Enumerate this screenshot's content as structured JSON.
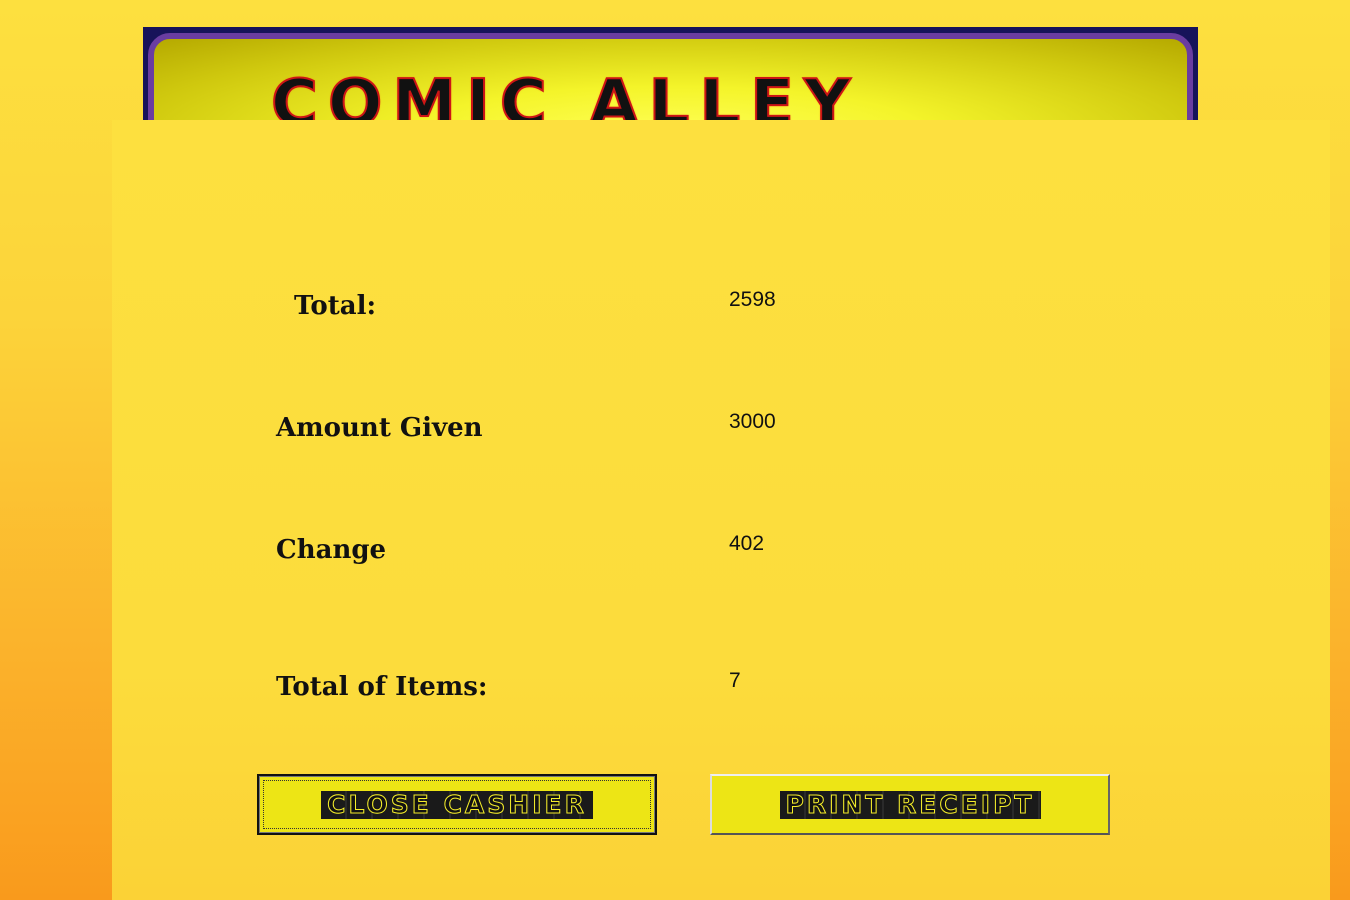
{
  "header": {
    "logo_text": "COMIC ALLEY"
  },
  "summary": {
    "total_label": "Total:",
    "total_value": "2598",
    "amount_given_label": "Amount Given",
    "amount_given_value": "3000",
    "change_label": "Change",
    "change_value": "402",
    "total_items_label": "Total of Items:",
    "total_items_value": "7"
  },
  "actions": {
    "close_cashier_label": "CLOSE CASHIER",
    "print_receipt_label": "PRINT RECEIPT"
  },
  "colors": {
    "background": "#fde03f",
    "button_fill": "#ede515",
    "logo_fill": "#111111",
    "logo_outline": "#cc1515"
  }
}
